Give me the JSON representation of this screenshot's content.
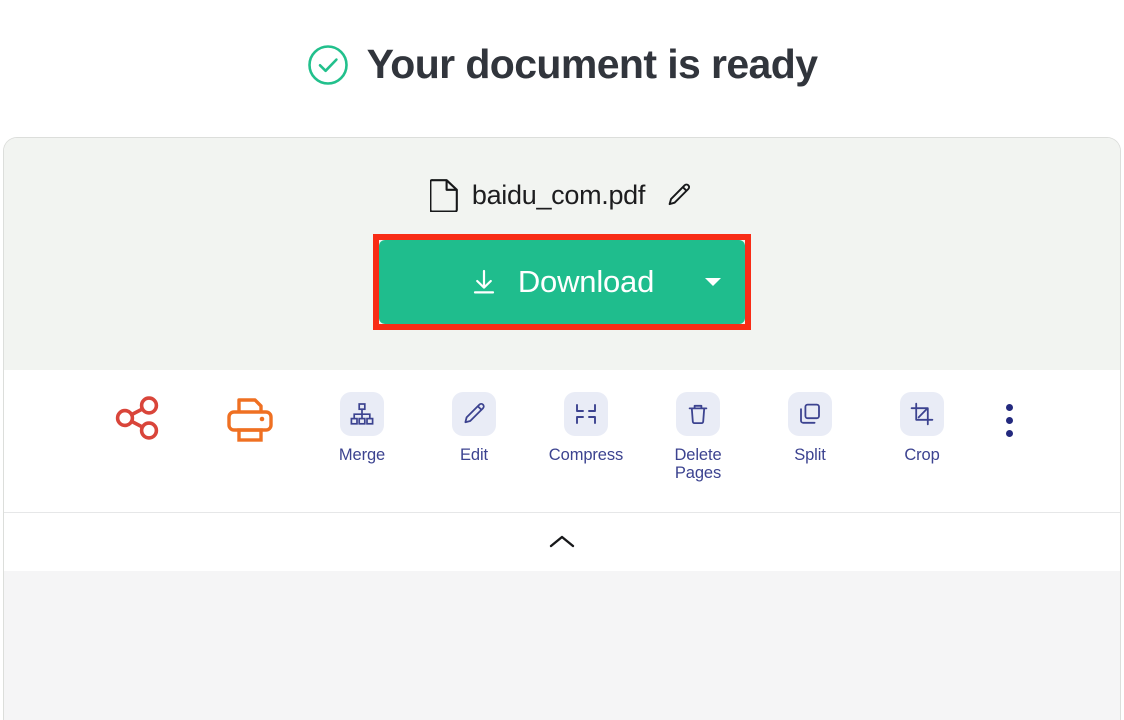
{
  "header": {
    "status_icon": "circle-check-icon",
    "title": "Your document is ready"
  },
  "document": {
    "file_icon": "file-icon",
    "filename": "baidu_com.pdf",
    "rename_icon": "pencil-icon"
  },
  "download": {
    "icon": "download-arrow-icon",
    "label": "Download",
    "dropdown_icon": "caret-down-icon",
    "button_color": "#1fbd8d",
    "highlight_color": "#f82c16"
  },
  "quick_actions": [
    {
      "name": "share",
      "icon": "share-nodes-icon",
      "color": "#d9453a"
    },
    {
      "name": "print",
      "icon": "printer-icon",
      "color": "#ef7022"
    }
  ],
  "tools": [
    {
      "name": "merge",
      "label": "Merge",
      "icon": "merge-hierarchy-icon"
    },
    {
      "name": "edit",
      "label": "Edit",
      "icon": "pencil-icon"
    },
    {
      "name": "compress",
      "label": "Compress",
      "icon": "compress-arrows-icon"
    },
    {
      "name": "delete-pages",
      "label": "Delete\nPages",
      "icon": "trash-icon"
    },
    {
      "name": "split",
      "label": "Split",
      "icon": "split-copy-icon"
    },
    {
      "name": "crop",
      "label": "Crop",
      "icon": "crop-icon"
    }
  ],
  "more": {
    "icon": "more-vertical-icon"
  },
  "collapse": {
    "icon": "chevron-up-icon"
  },
  "colors": {
    "tool_tile_bg": "#e9ecf6",
    "tool_icon": "#3c4390",
    "panel_bg": "#f2f4f1",
    "accent_green": "#1fbd8d"
  }
}
